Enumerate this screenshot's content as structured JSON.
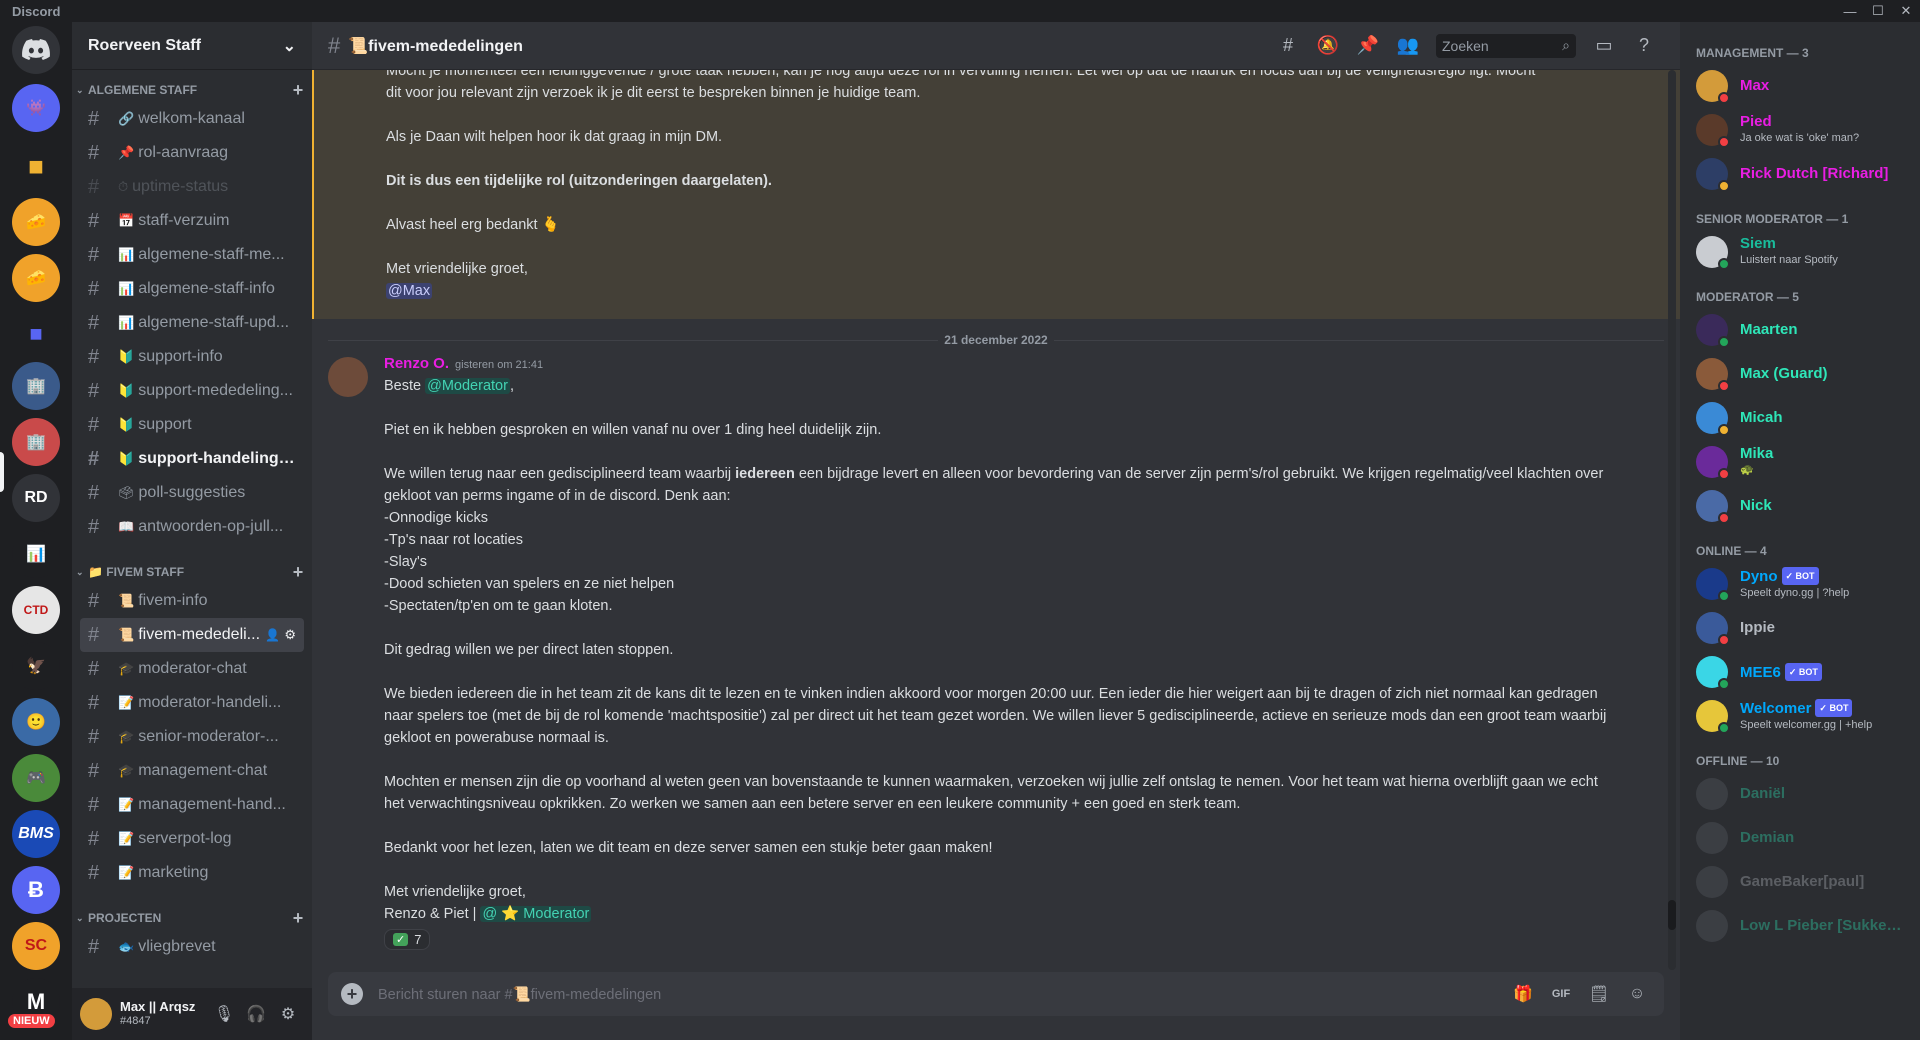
{
  "titlebar": {
    "app": "Discord",
    "min": "—",
    "max": "☐",
    "close": "✕"
  },
  "servers": {
    "rd_initials": "RD",
    "new_badge": "NIEUW",
    "bms": "BMS",
    "sc": "SC",
    "m": "M"
  },
  "guild": {
    "name": "Roerveen Staff",
    "chevron": "⌄"
  },
  "categories": [
    {
      "label": "Algemene staff",
      "channels": [
        {
          "emoji": "🔗",
          "name": "welkom-kanaal"
        },
        {
          "emoji": "📌",
          "name": "rol-aanvraag"
        },
        {
          "emoji": "⏱",
          "name": "uptime-status"
        },
        {
          "emoji": "📅",
          "name": "staff-verzuim"
        },
        {
          "emoji": "📊",
          "name": "algemene-staff-me..."
        },
        {
          "emoji": "📊",
          "name": "algemene-staff-info"
        },
        {
          "emoji": "📊",
          "name": "algemene-staff-upd..."
        },
        {
          "emoji": "🔰",
          "name": "support-info"
        },
        {
          "emoji": "🔰",
          "name": "support-mededeling..."
        },
        {
          "emoji": "🔰",
          "name": "support"
        },
        {
          "emoji": "🔰",
          "name": "support-handelingen"
        },
        {
          "emoji": "🗳",
          "name": "poll-suggesties"
        },
        {
          "emoji": "📖",
          "name": "antwoorden-op-jull..."
        }
      ]
    },
    {
      "label": "📁 Fivem staff",
      "channels": [
        {
          "emoji": "📜",
          "name": "fivem-info"
        },
        {
          "emoji": "📜",
          "name": "fivem-mededeli..."
        },
        {
          "emoji": "🎓",
          "name": "moderator-chat"
        },
        {
          "emoji": "📝",
          "name": "moderator-handeli..."
        },
        {
          "emoji": "🎓",
          "name": "senior-moderator-..."
        },
        {
          "emoji": "🎓",
          "name": "management-chat"
        },
        {
          "emoji": "📝",
          "name": "management-hand..."
        },
        {
          "emoji": "📝",
          "name": "serverpot-log"
        },
        {
          "emoji": "📝",
          "name": "marketing"
        }
      ]
    },
    {
      "label": "Projecten",
      "channels": [
        {
          "emoji": "🐟",
          "name": "vliegbrevet"
        }
      ]
    }
  ],
  "user": {
    "name": "Max || Arqsz",
    "discrim": "#4847"
  },
  "channel_header": {
    "title": "📜fivem-mededelingen",
    "search_placeholder": "Zoeken"
  },
  "prev_message": {
    "line1": "Mocht je momenteel een leidinggevende / grote taak hebben, kan je nog altijd deze rol in vervulling nemen. Let wel op dat de nadruk en focus dan bij de veiligheidsregio ligt. Mocht",
    "line2": "dit voor jou relevant zijn verzoek ik je dit eerst te bespreken binnen je huidige team.",
    "help": "Als je Daan wilt helpen hoor ik dat graag in mijn DM.",
    "bold": "Dit is dus een tijdelijke rol (uitzonderingen daargelaten).",
    "thanks": "Alvast heel erg bedankt 🫰",
    "regards": "Met vriendelijke groet,",
    "mention": "@Max"
  },
  "divider": "21 december 2022",
  "message": {
    "author": "Renzo O.",
    "timestamp": "gisteren om 21:41",
    "greet": "Beste",
    "mention": "@Moderator",
    "comma": ",",
    "p1": "Piet en ik hebben gesproken en willen vanaf nu over 1 ding heel duidelijk zijn.",
    "p2a": "We willen terug naar een gedisciplineerd team waarbij",
    "p2b": "iedereen",
    "p2c": "een bijdrage levert en alleen voor bevordering van de server zijn perm's/rol gebruikt. We krijgen regelmatig/veel klachten over gekloot van perms ingame of in de discord. Denk aan:",
    "list": [
      "-Onnodige kicks",
      "-Tp's naar rot locaties",
      "-Slay's",
      "-Dood schieten van spelers en ze niet helpen",
      "-Spectaten/tp'en om te gaan kloten."
    ],
    "p3": "Dit gedrag willen we per direct laten stoppen.",
    "p4": "We bieden iedereen die in het team zit de kans dit te lezen en te vinken indien akkoord voor morgen 20:00 uur. Een ieder die hier weigert aan bij te dragen of zich niet normaal kan gedragen naar spelers toe (met de bij de rol komende 'machtspositie') zal per direct uit het team gezet worden. We willen liever 5 gedisciplineerde, actieve en serieuze mods dan een groot team waarbij gekloot en powerabuse normaal is.",
    "p5": "Mochten er mensen zijn die op voorhand al weten geen van bovenstaande te kunnen waarmaken, verzoeken wij jullie zelf ontslag te nemen. Voor het team wat hierna overblijft gaan we echt het verwachtingsniveau opkrikken. Zo werken we samen aan een betere server en een leukere community + een goed en sterk team.",
    "p6": "Bedankt voor het lezen, laten we dit team en deze server samen een stukje beter gaan maken!",
    "regards": "Met vriendelijke groet,",
    "sign": "Renzo & Piet |",
    "sign_mention": "@ ⭐ Moderator",
    "reaction_emoji": "✓",
    "reaction_count": "7"
  },
  "composer": {
    "placeholder": "Bericht sturen naar #📜fivem-mededelingen",
    "plus": "+",
    "gif": "GIF"
  },
  "member_groups": [
    {
      "label": "Management — 3",
      "members": [
        {
          "name": "Max",
          "color": "#e91ee3",
          "avatar": "#d39b3a",
          "status": "#f23f43",
          "sub": ""
        },
        {
          "name": "Pied",
          "color": "#e91ee3",
          "avatar": "#5a3a2a",
          "status": "#f23f43",
          "sub": "Ja oke wat is 'oke' man?"
        },
        {
          "name": "Rick Dutch [Richard]",
          "color": "#e91ee3",
          "avatar": "#2d3e66",
          "status": "#f0b232",
          "sub": ""
        }
      ]
    },
    {
      "label": "Senior moderator — 1",
      "members": [
        {
          "name": "Siem",
          "color": "#1abc9c",
          "avatar": "#c9ccd1",
          "status": "#23a55a",
          "sub": "Luistert naar Spotify"
        }
      ]
    },
    {
      "label": "Moderator — 5",
      "members": [
        {
          "name": "Maarten",
          "color": "#2ee6b8",
          "avatar": "#3a2a5a",
          "status": "#23a55a",
          "sub": ""
        },
        {
          "name": "Max (Guard)",
          "color": "#2ee6b8",
          "avatar": "#8a5a3a",
          "status": "#f23f43",
          "sub": ""
        },
        {
          "name": "Micah",
          "color": "#2ee6b8",
          "avatar": "#3a8ad6",
          "status": "#f0b232",
          "sub": ""
        },
        {
          "name": "Mika",
          "color": "#2ee6b8",
          "avatar": "#6a2a9a",
          "status": "#f23f43",
          "sub": "🐢"
        },
        {
          "name": "Nick",
          "color": "#2ee6b8",
          "avatar": "#4a6aa6",
          "status": "#f23f43",
          "sub": ""
        }
      ]
    },
    {
      "label": "Online — 4",
      "members": [
        {
          "name": "Dyno",
          "color": "#00a8fc",
          "avatar": "#1a3a8a",
          "status": "#23a55a",
          "sub": "Speelt dyno.gg | ?help",
          "bot": "✓ BOT"
        },
        {
          "name": "Ippie",
          "color": "#b5bac1",
          "avatar": "#3a5a9a",
          "status": "#f23f43",
          "sub": ""
        },
        {
          "name": "MEE6",
          "color": "#00a8fc",
          "avatar": "#3ad6e6",
          "status": "#23a55a",
          "sub": "",
          "bot": "✓ BOT"
        },
        {
          "name": "Welcomer",
          "color": "#00a8fc",
          "avatar": "#e6c63a",
          "status": "#23a55a",
          "sub": "Speelt welcomer.gg | +help",
          "bot": "✓ BOT"
        }
      ]
    },
    {
      "label": "Offline — 10",
      "off": true,
      "members": [
        {
          "name": "Daniël",
          "color": "#2ee6b8",
          "avatar": "#5a5e66",
          "status": "",
          "sub": ""
        },
        {
          "name": "Demian",
          "color": "#2ee6b8",
          "avatar": "#5a5e66",
          "status": "",
          "sub": ""
        },
        {
          "name": "GameBaker[paul]",
          "color": "#b5bac1",
          "avatar": "#5a5e66",
          "status": "",
          "sub": ""
        },
        {
          "name": "Low L Pieber [Sukkel ...",
          "color": "#2ee6b8",
          "avatar": "#5a5e66",
          "status": "",
          "sub": ""
        }
      ]
    }
  ]
}
